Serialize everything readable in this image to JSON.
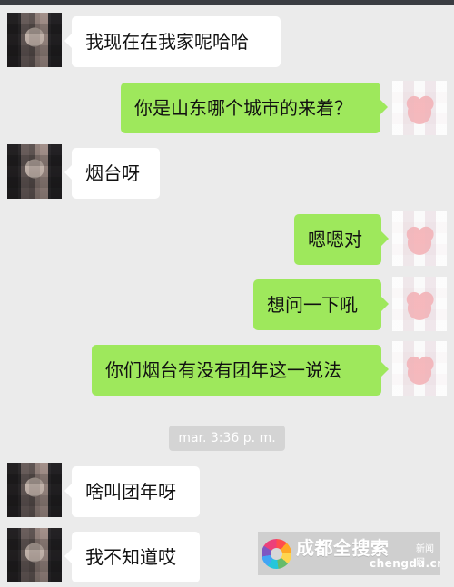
{
  "chat": {
    "messages": [
      {
        "text": "我现在在我家呢哈哈"
      },
      {
        "text": "你是山东哪个城市的来着？"
      },
      {
        "text": "烟台呀"
      },
      {
        "text": "嗯嗯对"
      },
      {
        "text": "想问一下吼"
      },
      {
        "text": "你们烟台有没有团年这一说法"
      },
      {
        "text": "啥叫团年呀"
      },
      {
        "text": "我不知道哎"
      }
    ],
    "timestamp": "mar. 3:36 p. m."
  },
  "watermark": {
    "title": "成都全搜索",
    "subtitle": "新闻网",
    "domain": "chengdu.cn"
  },
  "colors": {
    "background": "#ebebeb",
    "incoming_bubble": "#ffffff",
    "outgoing_bubble": "#9ee85c",
    "timestamp_bg": "#d4d4d4"
  }
}
